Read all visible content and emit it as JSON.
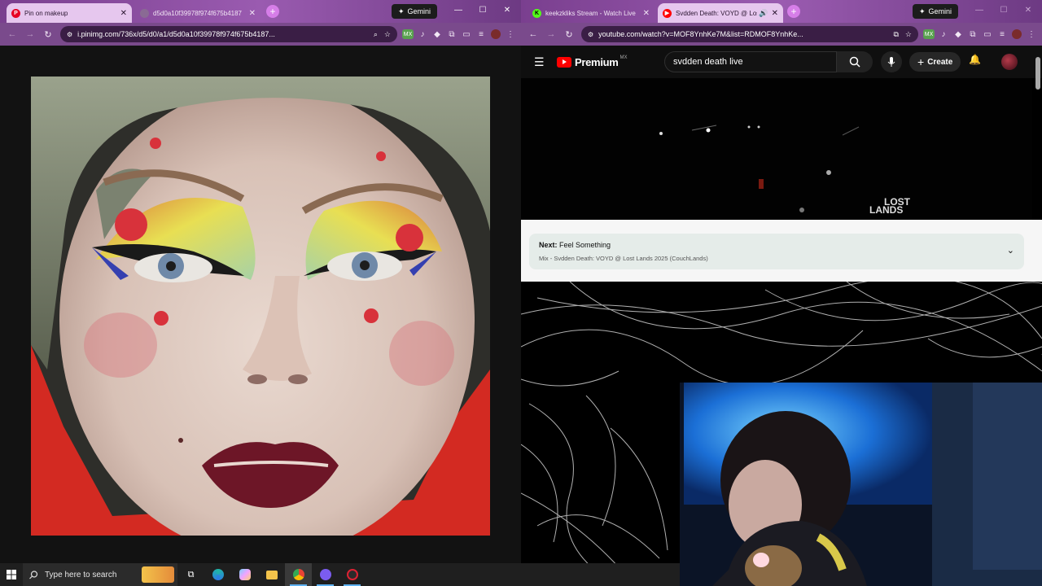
{
  "left_window": {
    "tabs": [
      {
        "label": "Pin on makeup",
        "favicon": "pinterest-icon",
        "active": true
      },
      {
        "label": "d5d0a10f39978f974f675b4187",
        "favicon": "image-tab-icon",
        "active": false
      }
    ],
    "gemini_label": "Gemini",
    "address_url": "i.pinimg.com/736x/d5/d0/a1/d5d0a10f39978f974f675b4187...",
    "ext_badge": "MX"
  },
  "right_window": {
    "tabs": [
      {
        "label": "keekzkliks Stream - Watch Live",
        "favicon": "kick-icon",
        "active": false
      },
      {
        "label": "Svdden Death: VOYD @ Lost",
        "favicon": "youtube-icon",
        "active": true
      }
    ],
    "gemini_label": "Gemini",
    "address_url": "youtube.com/watch?v=MOF8YnhKe7M&list=RDMOF8YnhKe...",
    "ext_badge": "MX"
  },
  "youtube": {
    "logo_text": "Premium",
    "logo_sup": "MX",
    "search_value": "svdden death live",
    "create_label": "Create",
    "video_overlay_text": "LOST\nLANDS",
    "next_prefix": "Next:",
    "next_title": "Feel Something",
    "next_playlist": "Mix - Svdden Death: VOYD @ Lost Lands 2025 (CouchLands)"
  },
  "taskbar": {
    "search_placeholder": "Type here to search"
  },
  "colors": {
    "chrome_frame": "#7a3f8f",
    "youtube_red": "#ff0000",
    "next_card_bg": "#e5ece9",
    "taskbar": "#1f1f1f"
  }
}
